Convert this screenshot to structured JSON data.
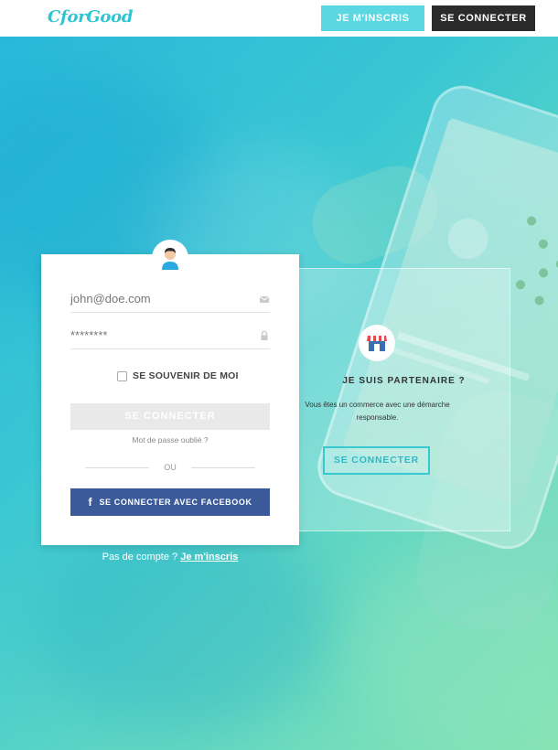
{
  "header": {
    "logo_text": "CforGood",
    "register_label": "JE M'INSCRIS",
    "login_label": "SE CONNECTER"
  },
  "login": {
    "email_value": "john@doe.com",
    "password_value": "********",
    "remember_label": "SE SOUVENIR DE MOI",
    "connect_label": "SE CONNECTER",
    "forgot_label": "Mot de passe oublié ?",
    "or_label": "OU",
    "facebook_icon": "f",
    "facebook_label": "SE CONNECTER AVEC FACEBOOK"
  },
  "signup": {
    "prompt": "Pas de compte ?",
    "link_label": "Je m'inscris"
  },
  "partner": {
    "title": "JE SUIS PARTENAIRE ?",
    "description": "Vous êtes un commerce avec une démarche responsable.",
    "button_label": "SE CONNECTER"
  },
  "colors": {
    "accent": "#38c8d2",
    "facebook": "#3b5a9a",
    "dark": "#2b2b2b"
  },
  "icons": [
    "user-avatar-icon",
    "mail-icon",
    "lock-icon",
    "facebook-icon",
    "shop-icon"
  ]
}
